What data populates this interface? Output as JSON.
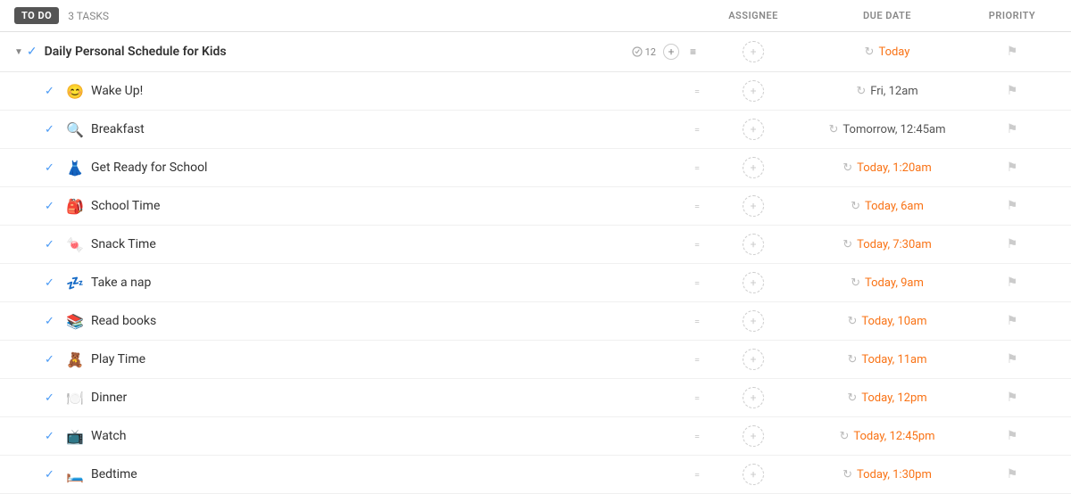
{
  "header": {
    "todo_label": "TO DO",
    "tasks_count": "3 TASKS",
    "col_assignee": "ASSIGNEE",
    "col_duedate": "DUE DATE",
    "col_priority": "PRIORITY"
  },
  "group": {
    "title": "Daily Personal Schedule for Kids",
    "subtask_count": "12",
    "today_label": "Today"
  },
  "tasks": [
    {
      "id": 1,
      "emoji": "😊",
      "name": "Wake Up!",
      "due": "Fri, 12am",
      "due_class": "normal"
    },
    {
      "id": 2,
      "emoji": "🔍",
      "name": "Breakfast",
      "due": "Tomorrow, 12:45am",
      "due_class": "normal"
    },
    {
      "id": 3,
      "emoji": "👗",
      "name": "Get Ready for School",
      "due": "Today, 1:20am",
      "due_class": "today"
    },
    {
      "id": 4,
      "emoji": "🎒",
      "name": "School Time",
      "due": "Today, 6am",
      "due_class": "today"
    },
    {
      "id": 5,
      "emoji": "🍬",
      "name": "Snack Time",
      "due": "Today, 7:30am",
      "due_class": "today"
    },
    {
      "id": 6,
      "emoji": "💤",
      "name": "Take a nap",
      "due": "Today, 9am",
      "due_class": "today"
    },
    {
      "id": 7,
      "emoji": "📚",
      "name": "Read books",
      "due": "Today, 10am",
      "due_class": "today"
    },
    {
      "id": 8,
      "emoji": "🧸",
      "name": "Play Time",
      "due": "Today, 11am",
      "due_class": "today"
    },
    {
      "id": 9,
      "emoji": "🍽️",
      "name": "Dinner",
      "due": "Today, 12pm",
      "due_class": "today"
    },
    {
      "id": 10,
      "emoji": "📺",
      "name": "Watch",
      "due": "Today, 12:45pm",
      "due_class": "today"
    },
    {
      "id": 11,
      "emoji": "🛏️",
      "name": "Bedtime",
      "due": "Today, 1:30pm",
      "due_class": "today"
    }
  ],
  "icons": {
    "check": "✓",
    "arrow_down": "▼",
    "clock": "↻",
    "flag": "⚑",
    "plus": "+",
    "menu": "≡",
    "drag": "≡",
    "avatar_plus": "+"
  }
}
